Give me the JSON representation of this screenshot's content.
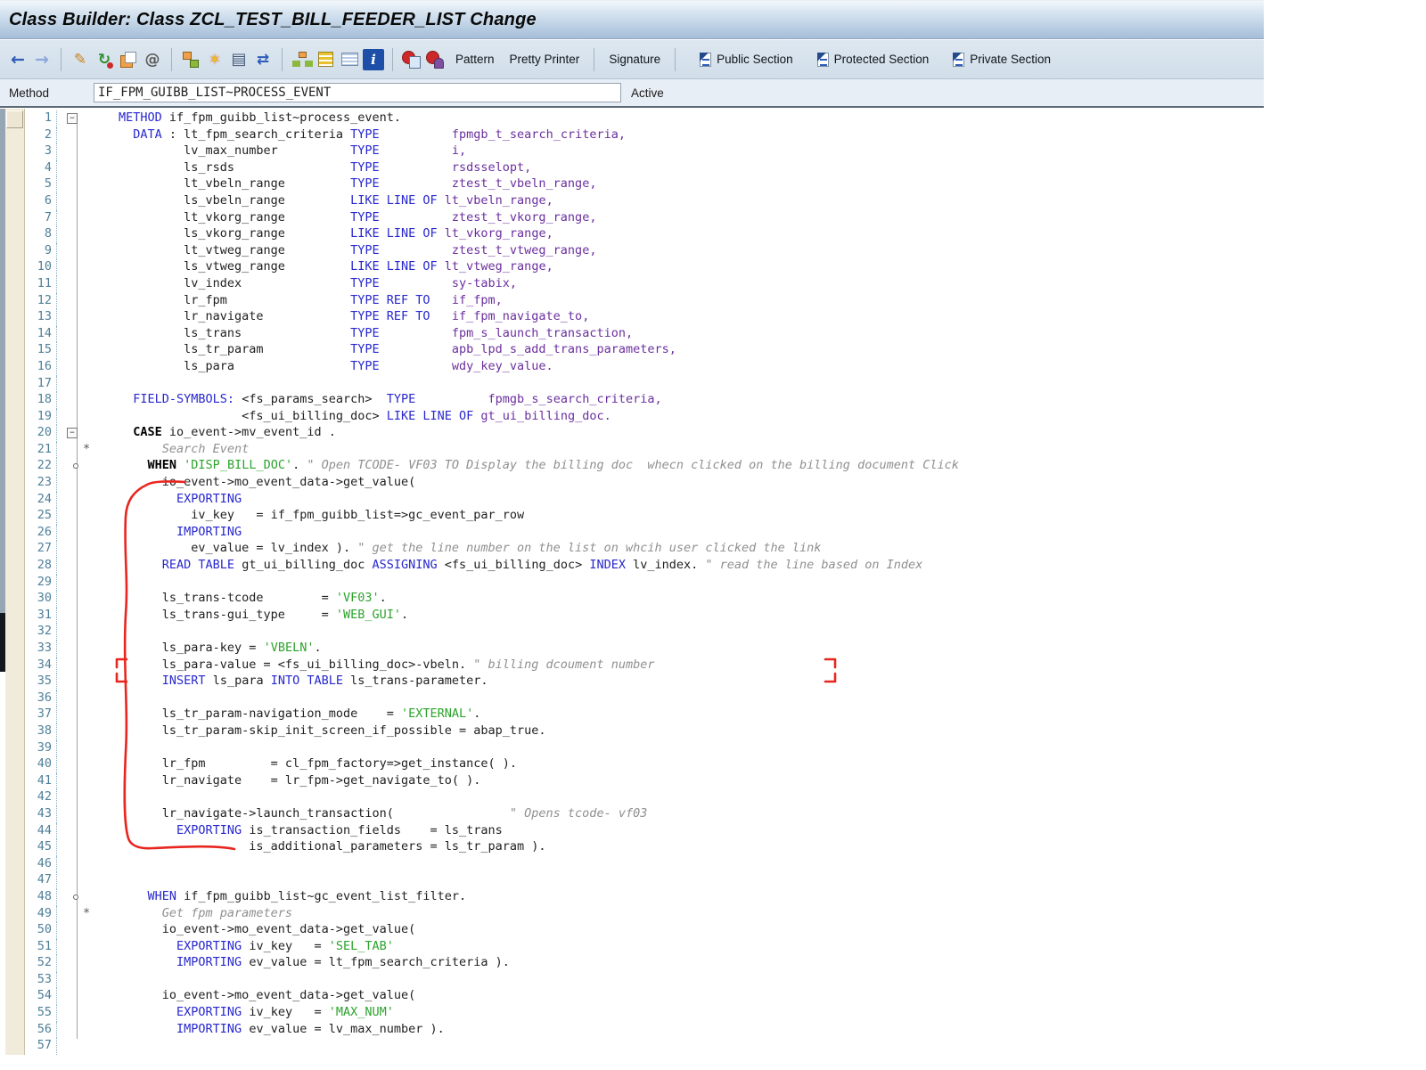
{
  "window": {
    "title": "Class Builder: Class ZCL_TEST_BILL_FEEDER_LIST Change"
  },
  "toolbar": {
    "items": [
      {
        "type": "icon",
        "name": "back-icon"
      },
      {
        "type": "icon",
        "name": "forward-icon"
      },
      {
        "type": "sep"
      },
      {
        "type": "icon",
        "name": "display-change-icon"
      },
      {
        "type": "icon",
        "name": "check-icon"
      },
      {
        "type": "icon",
        "name": "copy-icon"
      },
      {
        "type": "icon",
        "name": "generate-icon"
      },
      {
        "type": "sep"
      },
      {
        "type": "icon",
        "name": "where-used-icon"
      },
      {
        "type": "icon",
        "name": "activate-wand-icon"
      },
      {
        "type": "icon",
        "name": "print-icon"
      },
      {
        "type": "icon",
        "name": "navigate-icon"
      },
      {
        "type": "sep"
      },
      {
        "type": "icon",
        "name": "hierarchy-icon"
      },
      {
        "type": "icon",
        "name": "stack-icon"
      },
      {
        "type": "icon",
        "name": "detail-list-icon"
      },
      {
        "type": "icon",
        "name": "info-icon"
      },
      {
        "type": "sep"
      },
      {
        "type": "icon",
        "name": "syntax-check-icon"
      },
      {
        "type": "icon",
        "name": "test-icon"
      },
      {
        "type": "button",
        "name": "pattern-button",
        "label": "Pattern"
      },
      {
        "type": "button",
        "name": "pretty-printer-button",
        "label": "Pretty Printer"
      },
      {
        "type": "sep"
      },
      {
        "type": "button",
        "name": "signature-button",
        "label": "Signature"
      },
      {
        "type": "sep"
      },
      {
        "type": "section",
        "name": "public-section-button",
        "label": "Public Section"
      },
      {
        "type": "section",
        "name": "protected-section-button",
        "label": "Protected Section"
      },
      {
        "type": "section",
        "name": "private-section-button",
        "label": "Private Section"
      }
    ]
  },
  "method_bar": {
    "label": "Method",
    "value": "IF_FPM_GUIBB_LIST~PROCESS_EVENT",
    "status": "Active"
  },
  "editor": {
    "colors": {
      "keyword": "#2727CE",
      "type": "#6B2F9E",
      "string": "#2CA32C",
      "comment": "#8F8F8F",
      "line_number": "#4E7F99",
      "annotation": "#E8261F"
    },
    "lines": [
      {
        "n": 1,
        "m": "box",
        "s": [
          [
            "kw",
            "METHOD"
          ],
          [
            "pl",
            " if_fpm_guibb_list~process_event."
          ]
        ]
      },
      {
        "n": 2,
        "m": "",
        "s": [
          [
            "pl",
            "  "
          ],
          [
            "kw",
            "DATA"
          ],
          [
            "pl",
            " : lt_fpm_search_criteria "
          ],
          [
            "kw",
            "TYPE"
          ],
          [
            "pl",
            "          "
          ],
          [
            "typ",
            "fpmgb_t_search_criteria,"
          ]
        ]
      },
      {
        "n": 3,
        "m": "",
        "s": [
          [
            "pl",
            "         lv_max_number          "
          ],
          [
            "kw",
            "TYPE"
          ],
          [
            "pl",
            "          "
          ],
          [
            "typ",
            "i,"
          ]
        ]
      },
      {
        "n": 4,
        "m": "",
        "s": [
          [
            "pl",
            "         ls_rsds                "
          ],
          [
            "kw",
            "TYPE"
          ],
          [
            "pl",
            "          "
          ],
          [
            "typ",
            "rsdsselopt,"
          ]
        ]
      },
      {
        "n": 5,
        "m": "",
        "s": [
          [
            "pl",
            "         lt_vbeln_range         "
          ],
          [
            "kw",
            "TYPE"
          ],
          [
            "pl",
            "          "
          ],
          [
            "typ",
            "ztest_t_vbeln_range,"
          ]
        ]
      },
      {
        "n": 6,
        "m": "",
        "s": [
          [
            "pl",
            "         ls_vbeln_range         "
          ],
          [
            "kw",
            "LIKE LINE OF"
          ],
          [
            "pl",
            " "
          ],
          [
            "typ",
            "lt_vbeln_range,"
          ]
        ]
      },
      {
        "n": 7,
        "m": "",
        "s": [
          [
            "pl",
            "         lt_vkorg_range         "
          ],
          [
            "kw",
            "TYPE"
          ],
          [
            "pl",
            "          "
          ],
          [
            "typ",
            "ztest_t_vkorg_range,"
          ]
        ]
      },
      {
        "n": 8,
        "m": "",
        "s": [
          [
            "pl",
            "         ls_vkorg_range         "
          ],
          [
            "kw",
            "LIKE LINE OF"
          ],
          [
            "pl",
            " "
          ],
          [
            "typ",
            "lt_vkorg_range,"
          ]
        ]
      },
      {
        "n": 9,
        "m": "",
        "s": [
          [
            "pl",
            "         lt_vtweg_range         "
          ],
          [
            "kw",
            "TYPE"
          ],
          [
            "pl",
            "          "
          ],
          [
            "typ",
            "ztest_t_vtweg_range,"
          ]
        ]
      },
      {
        "n": 10,
        "m": "",
        "s": [
          [
            "pl",
            "         ls_vtweg_range         "
          ],
          [
            "kw",
            "LIKE LINE OF"
          ],
          [
            "pl",
            " "
          ],
          [
            "typ",
            "lt_vtweg_range,"
          ]
        ]
      },
      {
        "n": 11,
        "m": "",
        "s": [
          [
            "pl",
            "         lv_index               "
          ],
          [
            "kw",
            "TYPE"
          ],
          [
            "pl",
            "          "
          ],
          [
            "typ",
            "sy-tabix,"
          ]
        ]
      },
      {
        "n": 12,
        "m": "",
        "s": [
          [
            "pl",
            "         lr_fpm                 "
          ],
          [
            "kw",
            "TYPE REF TO"
          ],
          [
            "pl",
            "   "
          ],
          [
            "typ",
            "if_fpm,"
          ]
        ]
      },
      {
        "n": 13,
        "m": "",
        "s": [
          [
            "pl",
            "         lr_navigate            "
          ],
          [
            "kw",
            "TYPE REF TO"
          ],
          [
            "pl",
            "   "
          ],
          [
            "typ",
            "if_fpm_navigate_to,"
          ]
        ]
      },
      {
        "n": 14,
        "m": "",
        "s": [
          [
            "pl",
            "         ls_trans               "
          ],
          [
            "kw",
            "TYPE"
          ],
          [
            "pl",
            "          "
          ],
          [
            "typ",
            "fpm_s_launch_transaction,"
          ]
        ]
      },
      {
        "n": 15,
        "m": "",
        "s": [
          [
            "pl",
            "         ls_tr_param            "
          ],
          [
            "kw",
            "TYPE"
          ],
          [
            "pl",
            "          "
          ],
          [
            "typ",
            "apb_lpd_s_add_trans_parameters,"
          ]
        ]
      },
      {
        "n": 16,
        "m": "",
        "s": [
          [
            "pl",
            "         ls_para                "
          ],
          [
            "kw",
            "TYPE"
          ],
          [
            "pl",
            "          "
          ],
          [
            "typ",
            "wdy_key_value."
          ]
        ]
      },
      {
        "n": 17,
        "m": "",
        "s": []
      },
      {
        "n": 18,
        "m": "",
        "s": [
          [
            "pl",
            "  "
          ],
          [
            "kw",
            "FIELD-SYMBOLS:"
          ],
          [
            "pl",
            " <fs_params_search>  "
          ],
          [
            "kw",
            "TYPE"
          ],
          [
            "pl",
            "          "
          ],
          [
            "typ",
            "fpmgb_s_search_criteria,"
          ]
        ]
      },
      {
        "n": 19,
        "m": "",
        "s": [
          [
            "pl",
            "                 <fs_ui_billing_doc> "
          ],
          [
            "kw",
            "LIKE LINE OF"
          ],
          [
            "pl",
            " "
          ],
          [
            "typ",
            "gt_ui_billing_doc."
          ]
        ]
      },
      {
        "n": 20,
        "m": "box",
        "s": [
          [
            "pl",
            "  "
          ],
          [
            "b",
            "CASE"
          ],
          [
            "pl",
            " io_event->mv_event_id ."
          ]
        ]
      },
      {
        "n": 21,
        "m": "star",
        "s": [
          [
            "com",
            "      Search Event"
          ]
        ]
      },
      {
        "n": 22,
        "m": "circle",
        "s": [
          [
            "pl",
            "    "
          ],
          [
            "b",
            "WHEN"
          ],
          [
            "pl",
            " "
          ],
          [
            "str",
            "'DISP_BILL_DOC'"
          ],
          [
            "pl",
            ". "
          ],
          [
            "com",
            "\" Open TCODE- VF03 TO Display the billing doc  whecn clicked on the billing document Click"
          ]
        ]
      },
      {
        "n": 23,
        "m": "",
        "s": [
          [
            "pl",
            "      io_event->mo_event_data->get_value("
          ]
        ]
      },
      {
        "n": 24,
        "m": "",
        "s": [
          [
            "pl",
            "        "
          ],
          [
            "kw",
            "EXPORTING"
          ]
        ]
      },
      {
        "n": 25,
        "m": "",
        "s": [
          [
            "pl",
            "          iv_key   = if_fpm_guibb_list=>gc_event_par_row"
          ]
        ]
      },
      {
        "n": 26,
        "m": "",
        "s": [
          [
            "pl",
            "        "
          ],
          [
            "kw",
            "IMPORTING"
          ]
        ]
      },
      {
        "n": 27,
        "m": "",
        "s": [
          [
            "pl",
            "          ev_value = lv_index ). "
          ],
          [
            "com",
            "\" get the line number on the list on whcih user clicked the link"
          ]
        ]
      },
      {
        "n": 28,
        "m": "",
        "s": [
          [
            "pl",
            "      "
          ],
          [
            "kw",
            "READ TABLE"
          ],
          [
            "pl",
            " gt_ui_billing_doc "
          ],
          [
            "kw",
            "ASSIGNING"
          ],
          [
            "pl",
            " <fs_ui_billing_doc> "
          ],
          [
            "kw",
            "INDEX"
          ],
          [
            "pl",
            " lv_index. "
          ],
          [
            "com",
            "\" read the line based on Index"
          ]
        ]
      },
      {
        "n": 29,
        "m": "",
        "s": []
      },
      {
        "n": 30,
        "m": "",
        "s": [
          [
            "pl",
            "      ls_trans-tcode        = "
          ],
          [
            "str",
            "'VF03'"
          ],
          [
            "pl",
            "."
          ]
        ]
      },
      {
        "n": 31,
        "m": "",
        "s": [
          [
            "pl",
            "      ls_trans-gui_type     = "
          ],
          [
            "str",
            "'WEB_GUI'"
          ],
          [
            "pl",
            "."
          ]
        ]
      },
      {
        "n": 32,
        "m": "",
        "s": []
      },
      {
        "n": 33,
        "m": "",
        "s": [
          [
            "pl",
            "      ls_para-key = "
          ],
          [
            "str",
            "'VBELN'"
          ],
          [
            "pl",
            "."
          ]
        ]
      },
      {
        "n": 34,
        "m": "",
        "s": [
          [
            "pl",
            "      ls_para-value = <fs_ui_billing_doc>-vbeln. "
          ],
          [
            "com",
            "\" billing dcoument number"
          ]
        ]
      },
      {
        "n": 35,
        "m": "",
        "s": [
          [
            "pl",
            "      "
          ],
          [
            "kw",
            "INSERT"
          ],
          [
            "pl",
            " ls_para "
          ],
          [
            "kw",
            "INTO TABLE"
          ],
          [
            "pl",
            " ls_trans-parameter."
          ]
        ]
      },
      {
        "n": 36,
        "m": "",
        "s": []
      },
      {
        "n": 37,
        "m": "",
        "s": [
          [
            "pl",
            "      ls_tr_param-navigation_mode    = "
          ],
          [
            "str",
            "'EXTERNAL'"
          ],
          [
            "pl",
            "."
          ]
        ]
      },
      {
        "n": 38,
        "m": "",
        "s": [
          [
            "pl",
            "      ls_tr_param-skip_init_screen_if_possible = abap_true."
          ]
        ]
      },
      {
        "n": 39,
        "m": "",
        "s": []
      },
      {
        "n": 40,
        "m": "",
        "s": [
          [
            "pl",
            "      lr_fpm         = cl_fpm_factory=>get_instance( )."
          ]
        ]
      },
      {
        "n": 41,
        "m": "",
        "s": [
          [
            "pl",
            "      lr_navigate    = lr_fpm->get_navigate_to( )."
          ]
        ]
      },
      {
        "n": 42,
        "m": "",
        "s": []
      },
      {
        "n": 43,
        "m": "",
        "s": [
          [
            "pl",
            "      lr_navigate->launch_transaction(                "
          ],
          [
            "com",
            "\" Opens tcode- vf03"
          ]
        ]
      },
      {
        "n": 44,
        "m": "",
        "s": [
          [
            "pl",
            "        "
          ],
          [
            "kw",
            "EXPORTING"
          ],
          [
            "pl",
            " is_transaction_fields    = ls_trans"
          ]
        ]
      },
      {
        "n": 45,
        "m": "",
        "s": [
          [
            "pl",
            "                  is_additional_parameters = ls_tr_param )."
          ]
        ]
      },
      {
        "n": 46,
        "m": "",
        "s": []
      },
      {
        "n": 47,
        "m": "",
        "s": []
      },
      {
        "n": 48,
        "m": "circle",
        "s": [
          [
            "pl",
            "    "
          ],
          [
            "kw",
            "WHEN"
          ],
          [
            "pl",
            " if_fpm_guibb_list~gc_event_list_filter."
          ]
        ]
      },
      {
        "n": 49,
        "m": "star",
        "s": [
          [
            "com",
            "      Get fpm parameters"
          ]
        ]
      },
      {
        "n": 50,
        "m": "",
        "s": [
          [
            "pl",
            "      io_event->mo_event_data->get_value("
          ]
        ]
      },
      {
        "n": 51,
        "m": "",
        "s": [
          [
            "pl",
            "        "
          ],
          [
            "kw",
            "EXPORTING"
          ],
          [
            "pl",
            " iv_key   = "
          ],
          [
            "str",
            "'SEL_TAB'"
          ]
        ]
      },
      {
        "n": 52,
        "m": "",
        "s": [
          [
            "pl",
            "        "
          ],
          [
            "kw",
            "IMPORTING"
          ],
          [
            "pl",
            " ev_value = lt_fpm_search_criteria )."
          ]
        ]
      },
      {
        "n": 53,
        "m": "",
        "s": []
      },
      {
        "n": 54,
        "m": "",
        "s": [
          [
            "pl",
            "      io_event->mo_event_data->get_value("
          ]
        ]
      },
      {
        "n": 55,
        "m": "",
        "s": [
          [
            "pl",
            "        "
          ],
          [
            "kw",
            "EXPORTING"
          ],
          [
            "pl",
            " iv_key   = "
          ],
          [
            "str",
            "'MAX_NUM'"
          ]
        ]
      },
      {
        "n": 56,
        "m": "",
        "s": [
          [
            "pl",
            "        "
          ],
          [
            "kw",
            "IMPORTING"
          ],
          [
            "pl",
            " ev_value = lv_max_number )."
          ]
        ]
      },
      {
        "n": 57,
        "m": "",
        "s": []
      }
    ]
  }
}
